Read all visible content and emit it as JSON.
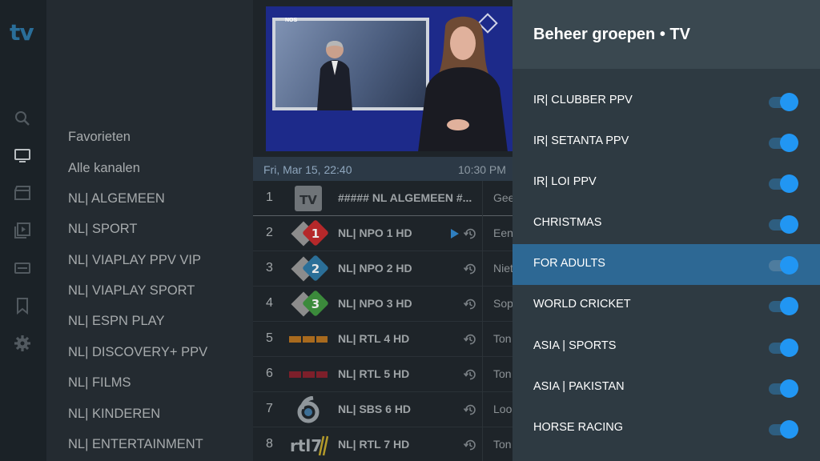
{
  "logo": "tv",
  "rail_icons": [
    "search-icon",
    "tv-icon",
    "movie-clapper-icon",
    "series-play-icon",
    "dvr-icon",
    "bookmark-icon",
    "gear-icon"
  ],
  "groups": [
    "Favorieten",
    "Alle kanalen",
    "NL| ALGEMEEN",
    "NL| SPORT",
    "NL| VIAPLAY PPV VIP",
    "NL| VIAPLAY SPORT",
    "NL| ESPN PLAY",
    "NL| DISCOVERY+ PPV",
    "NL| FILMS",
    "NL| KINDEREN",
    "NL| ENTERTAINMENT"
  ],
  "player": {
    "channel_tag": "NOS"
  },
  "guide": {
    "date": "Fri, Mar 15, 22:40",
    "time": "10:30 PM"
  },
  "channels": [
    {
      "num": "1",
      "name": "##### NL ALGEMEEN #...",
      "logo": "TV",
      "epg": "Gee"
    },
    {
      "num": "2",
      "name": "NL| NPO 1 HD",
      "logo": "npo-1",
      "epg": "Een"
    },
    {
      "num": "3",
      "name": "NL| NPO 2 HD",
      "logo": "npo-2",
      "epg": "Niet"
    },
    {
      "num": "4",
      "name": "NL| NPO 3 HD",
      "logo": "npo-3",
      "epg": "Sop"
    },
    {
      "num": "5",
      "name": "NL| RTL 4 HD",
      "logo": "rtl-4",
      "epg": "Ton"
    },
    {
      "num": "6",
      "name": "NL| RTL 5 HD",
      "logo": "rtl-5",
      "epg": "Ton"
    },
    {
      "num": "7",
      "name": "NL| SBS 6 HD",
      "logo": "sbs-6",
      "epg": "Loo"
    },
    {
      "num": "8",
      "name": "NL| RTL 7 HD",
      "logo": "rtl-7",
      "epg": "Ton"
    }
  ],
  "panel": {
    "title": "Beheer groepen  •  TV",
    "items": [
      {
        "label": "IR| CLUBBER PPV",
        "enabled": true
      },
      {
        "label": "IR| SETANTA PPV",
        "enabled": true
      },
      {
        "label": "IR| LOI PPV",
        "enabled": true
      },
      {
        "label": "CHRISTMAS",
        "enabled": true
      },
      {
        "label": "FOR ADULTS",
        "enabled": true,
        "selected": true
      },
      {
        "label": "WORLD CRICKET",
        "enabled": true
      },
      {
        "label": "ASIA | SPORTS",
        "enabled": true
      },
      {
        "label": "ASIA | PAKISTAN",
        "enabled": true
      },
      {
        "label": "HORSE RACING",
        "enabled": true
      }
    ]
  },
  "colors": {
    "accent": "#2196f3",
    "selected_row": "#2d6894",
    "panel_bg": "#2e3a42",
    "panel_header": "#3a4850"
  }
}
